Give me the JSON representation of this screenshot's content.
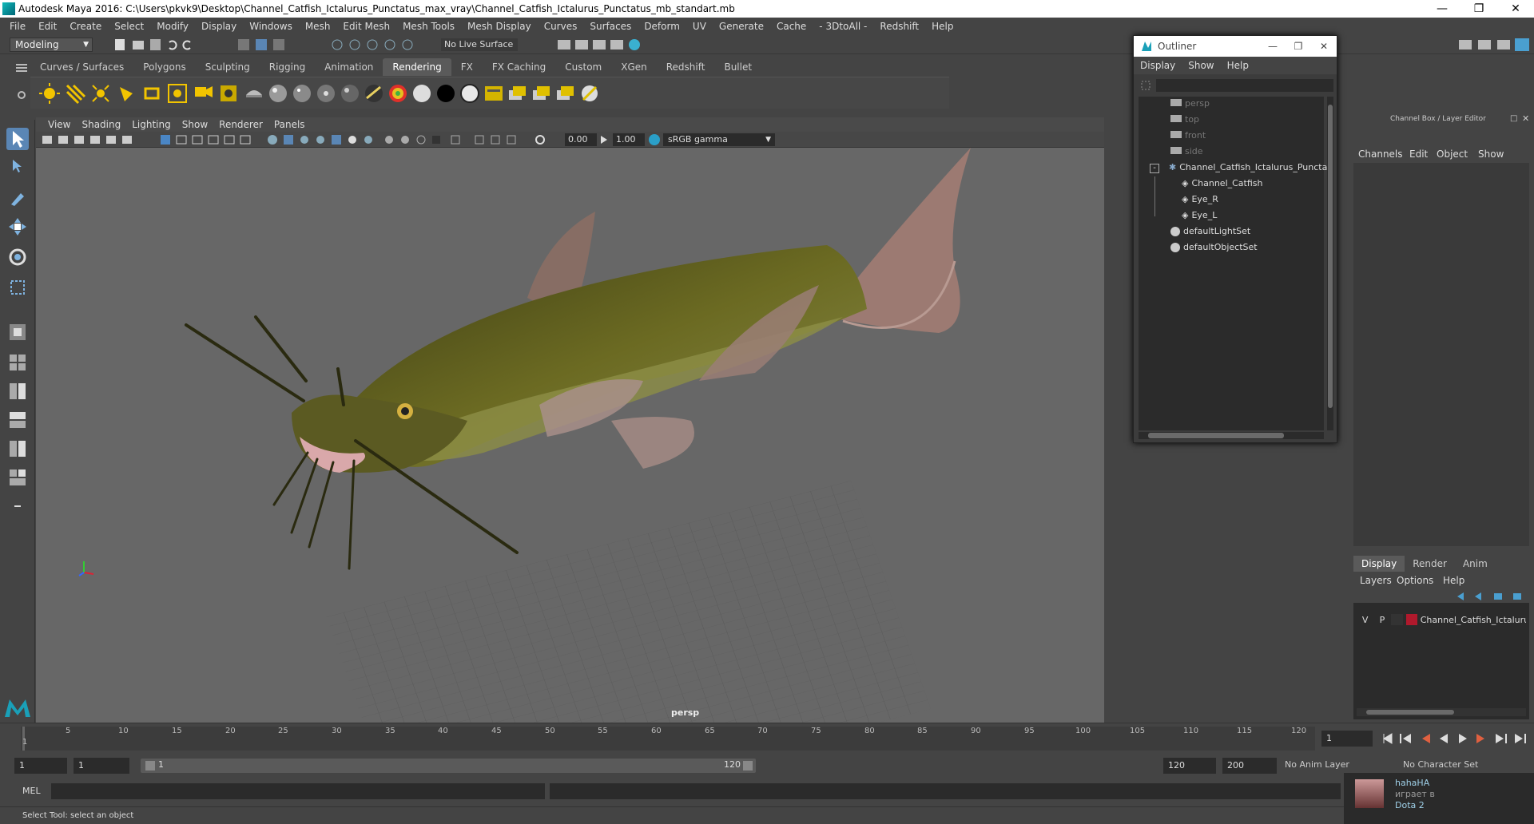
{
  "title": "Autodesk Maya 2016: C:\\Users\\pkvk9\\Desktop\\Channel_Catfish_Ictalurus_Punctatus_max_vray\\Channel_Catfish_Ictalurus_Punctatus_mb_standart.mb",
  "window_buttons": [
    "—",
    "❐",
    "✕"
  ],
  "menu": [
    "File",
    "Edit",
    "Create",
    "Select",
    "Modify",
    "Display",
    "Windows",
    "Mesh",
    "Edit Mesh",
    "Mesh Tools",
    "Mesh Display",
    "Curves",
    "Surfaces",
    "Deform",
    "UV",
    "Generate",
    "Cache",
    "- 3DtoAll -",
    "Redshift",
    "Help"
  ],
  "status": {
    "mode": "Modeling",
    "live_surface": "No Live Surface"
  },
  "shelf_tabs": [
    "Curves / Surfaces",
    "Polygons",
    "Sculpting",
    "Rigging",
    "Animation",
    "Rendering",
    "FX",
    "FX Caching",
    "Custom",
    "XGen",
    "Redshift",
    "Bullet"
  ],
  "active_shelf": "Rendering",
  "viewport": {
    "menu": [
      "View",
      "Shading",
      "Lighting",
      "Show",
      "Renderer",
      "Panels"
    ],
    "exposure": "0.00",
    "gamma_value": "1.00",
    "color_space": "sRGB gamma",
    "camera": "persp"
  },
  "outliner": {
    "title": "Outliner",
    "menu": [
      "Display",
      "Show",
      "Help"
    ],
    "items": [
      {
        "label": "persp",
        "type": "camera"
      },
      {
        "label": "top",
        "type": "camera"
      },
      {
        "label": "front",
        "type": "camera"
      },
      {
        "label": "side",
        "type": "camera"
      },
      {
        "label": "Channel_Catfish_Ictalurus_Punctat",
        "type": "group"
      },
      {
        "label": "Channel_Catfish",
        "type": "mesh"
      },
      {
        "label": "Eye_R",
        "type": "mesh"
      },
      {
        "label": "Eye_L",
        "type": "mesh"
      },
      {
        "label": "defaultLightSet",
        "type": "set"
      },
      {
        "label": "defaultObjectSet",
        "type": "set"
      }
    ]
  },
  "channel_box": {
    "title": "Channel Box / Layer Editor",
    "menu": [
      "Channels",
      "Edit",
      "Object",
      "Show"
    ]
  },
  "layer_editor": {
    "tabs": [
      "Display",
      "Render",
      "Anim"
    ],
    "menu": [
      "Layers",
      "Options",
      "Help"
    ],
    "layer": {
      "v": "V",
      "p": "P",
      "name": "Channel_Catfish_Ictaluru",
      "color": "#b0192c"
    }
  },
  "timeline": {
    "ticks": [
      "5",
      "10",
      "15",
      "20",
      "25",
      "30",
      "35",
      "40",
      "45",
      "50",
      "55",
      "60",
      "65",
      "70",
      "75",
      "80",
      "85",
      "90",
      "95",
      "100",
      "105",
      "110",
      "115",
      "120"
    ],
    "current_marker": "1",
    "current_frame": "1"
  },
  "range": {
    "start": "1",
    "playback_start": "1",
    "slider_start": "1",
    "slider_end": "120",
    "end": "120",
    "total_end": "200",
    "anim_layer": "No Anim Layer",
    "char_set": "No Character Set"
  },
  "mel": {
    "label": "MEL"
  },
  "help_text": "Select Tool: select an object",
  "notification": {
    "user": "hahaHA",
    "status": "играет в",
    "game": "Dota 2"
  }
}
